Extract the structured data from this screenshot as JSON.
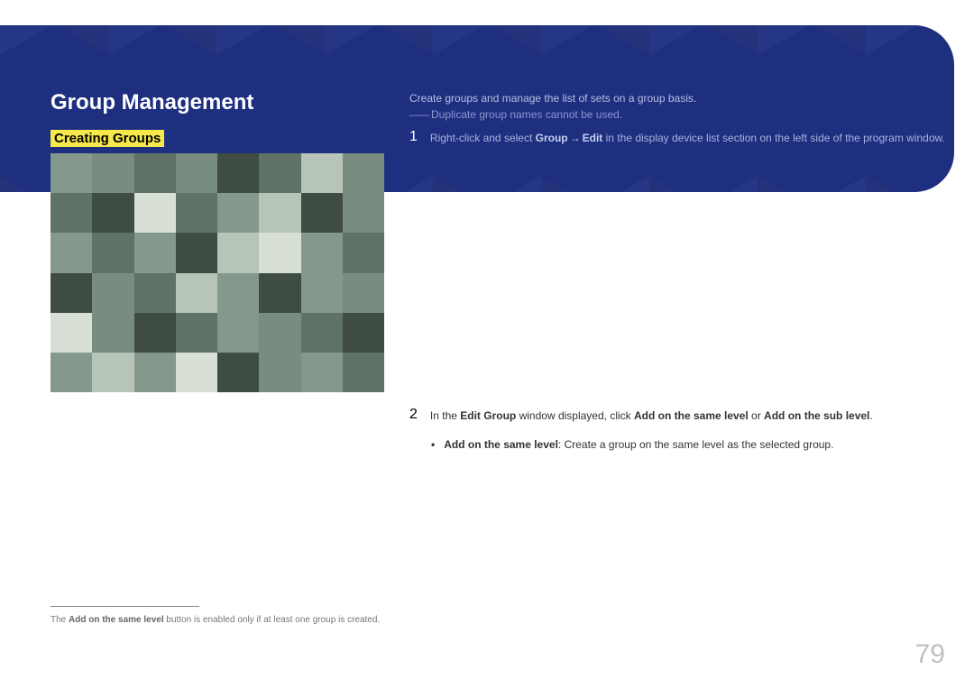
{
  "page": {
    "title": "Group Management",
    "subtitle": "Creating Groups",
    "intro": "Create groups and manage the list of sets on a group basis.",
    "note_prefix": "――",
    "note": "Duplicate group names cannot be used.",
    "page_number": "79"
  },
  "steps": {
    "s1": {
      "num": "1",
      "pre": "Right-click and select ",
      "b1": "Group",
      "arrow": "→",
      "b2": "Edit",
      "post": " in the display device list section on the left side of the program window."
    },
    "s2": {
      "num": "2",
      "pre": "In the ",
      "b1": "Edit Group",
      "mid1": " window displayed, click ",
      "b2": "Add on the same level",
      "mid2": " or ",
      "b3": "Add on the sub level",
      "post": "."
    }
  },
  "bullet": {
    "dot": "•",
    "label": "Add on the same level",
    "text": ": Create a group on the same level as the selected group."
  },
  "footnote": {
    "pre": "The ",
    "b": "Add on the same level",
    "post": " button is enabled only if at least one group is created."
  }
}
